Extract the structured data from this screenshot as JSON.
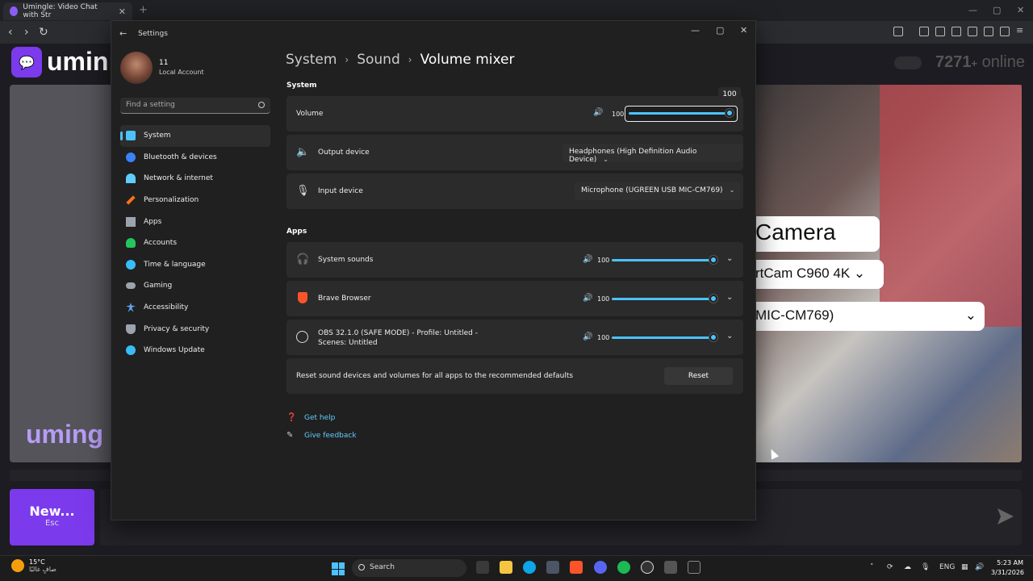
{
  "browser": {
    "tab_title": "Umingle: Video Chat with Str",
    "new_tab": "+",
    "tab_close": "✕"
  },
  "site": {
    "brand": "umin",
    "brand_bottom": "uming",
    "online_count": "7271",
    "online_plus": "+",
    "online_suffix": "online",
    "camera_title": "Camera",
    "camera_select": "rtCam C960 4K",
    "mic_select": "MIC-CM769)",
    "new_button": "New...",
    "new_button_hint": "Esc"
  },
  "settings": {
    "window_title": "Settings",
    "user_name": "11",
    "user_sub": "Local Account",
    "search_placeholder": "Find a setting",
    "nav": [
      {
        "label": "System",
        "icon": "monitor-icon",
        "color": "#4cc2ff"
      },
      {
        "label": "Bluetooth & devices",
        "icon": "bluetooth-icon",
        "color": "#3b82f6"
      },
      {
        "label": "Network & internet",
        "icon": "wifi-icon",
        "color": "#60cdff"
      },
      {
        "label": "Personalization",
        "icon": "brush-icon",
        "color": "#f97316"
      },
      {
        "label": "Apps",
        "icon": "apps-icon",
        "color": "#9ca3af"
      },
      {
        "label": "Accounts",
        "icon": "person-icon",
        "color": "#22c55e"
      },
      {
        "label": "Time & language",
        "icon": "globe-clock-icon",
        "color": "#38bdf8"
      },
      {
        "label": "Gaming",
        "icon": "controller-icon",
        "color": "#9ca3af"
      },
      {
        "label": "Accessibility",
        "icon": "accessibility-icon",
        "color": "#60a5fa"
      },
      {
        "label": "Privacy & security",
        "icon": "shield-icon",
        "color": "#9ca3af"
      },
      {
        "label": "Windows Update",
        "icon": "update-icon",
        "color": "#38bdf8"
      }
    ],
    "breadcrumb": {
      "a": "System",
      "b": "Sound",
      "c": "Volume mixer",
      "sep": "›"
    },
    "system_header": "System",
    "volume": {
      "label": "Volume",
      "value": "100",
      "tooltip": "100",
      "level": 100
    },
    "output": {
      "label": "Output device",
      "value": "Headphones (High Definition Audio Device)"
    },
    "input": {
      "label": "Input device",
      "value": "Microphone (UGREEN USB MIC-CM769)"
    },
    "apps_header": "Apps",
    "apps": [
      {
        "label": "System sounds",
        "value": "100",
        "level": 100
      },
      {
        "label": "Brave Browser",
        "value": "100",
        "level": 100
      },
      {
        "label": "OBS 32.1.0 (SAFE MODE) - Profile: Untitled -",
        "label2": "Scenes: Untitled",
        "value": "100",
        "level": 100
      }
    ],
    "reset_text": "Reset sound devices and volumes for all apps to the recommended defaults",
    "reset_button": "Reset",
    "get_help": "Get help",
    "give_feedback": "Give feedback"
  },
  "taskbar": {
    "temp": "15°C",
    "condition": "صافٍ غالبًا",
    "search": "Search",
    "lang": "ENG",
    "time": "5:23 AM",
    "date": "3/31/2026"
  },
  "colors": {
    "accent": "#4cc2ff",
    "brand": "#7c3aed",
    "link": "#60cdff"
  }
}
